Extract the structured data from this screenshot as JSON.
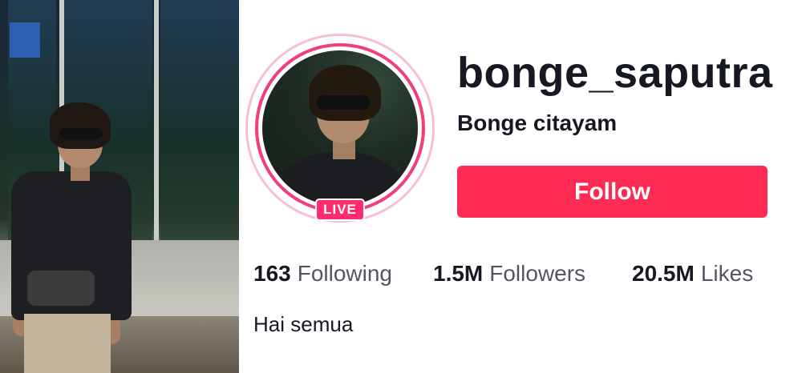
{
  "profile": {
    "username": "bonge_saputra",
    "nickname": "Bonge citayam",
    "live_badge": "LIVE",
    "follow_label": "Follow",
    "bio": "Hai semua"
  },
  "stats": {
    "following": {
      "count": "163",
      "label": "Following"
    },
    "followers": {
      "count": "1.5M",
      "label": "Followers"
    },
    "likes": {
      "count": "20.5M",
      "label": "Likes"
    }
  },
  "colors": {
    "accent": "#fe2c55",
    "live_badge": "#ff2d6f",
    "text_primary": "#161823",
    "text_secondary": "#545563"
  }
}
